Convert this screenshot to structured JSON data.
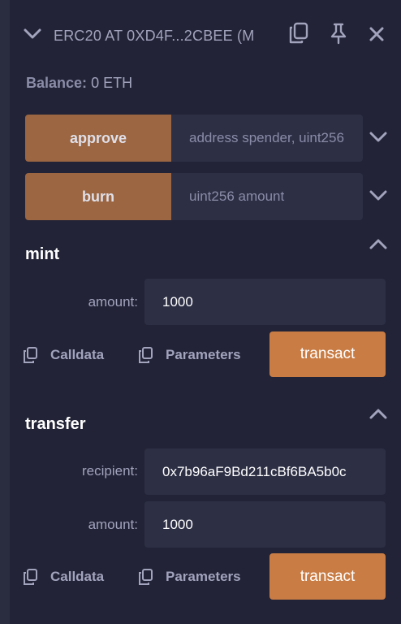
{
  "header": {
    "title": "ERC20 AT 0XD4F...2CBEE (M",
    "icons": [
      "chevron-down-icon",
      "copy-icon",
      "pin-icon",
      "close-icon"
    ]
  },
  "balance": {
    "label": "Balance:",
    "value": "0 ETH"
  },
  "functions": [
    {
      "name": "approve",
      "placeholder": "address spender, uint256"
    },
    {
      "name": "burn",
      "placeholder": "uint256 amount"
    }
  ],
  "mint": {
    "title": "mint",
    "args": [
      {
        "label": "amount:",
        "value": "1000"
      }
    ],
    "calldata_label": "Calldata",
    "parameters_label": "Parameters",
    "transact_label": "transact"
  },
  "transfer": {
    "title": "transfer",
    "args": [
      {
        "label": "recipient:",
        "value": "0x7b96aF9Bd211cBf6BA5b0c"
      },
      {
        "label": "amount:",
        "value": "1000"
      }
    ],
    "calldata_label": "Calldata",
    "parameters_label": "Parameters",
    "transact_label": "transact"
  },
  "colors": {
    "background": "#222336",
    "accent": "#c97d45",
    "function_button": "#9b6641",
    "input": "#2d2f45"
  }
}
